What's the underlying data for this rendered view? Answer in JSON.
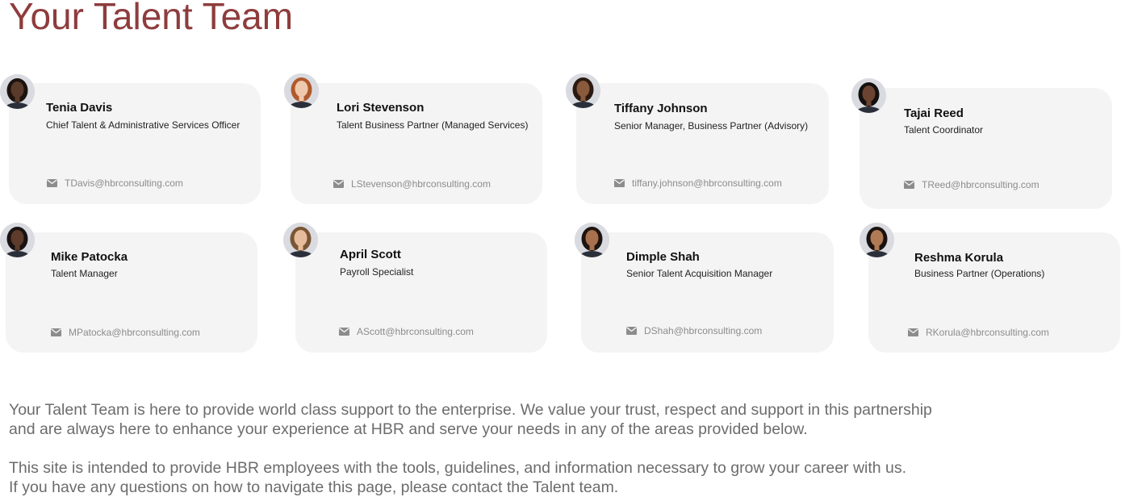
{
  "page": {
    "title": "Your Talent Team"
  },
  "team": [
    {
      "name": "Tenia Davis",
      "role": "Chief Talent & Administrative Services Officer",
      "email": "TDavis@hbrconsulting.com",
      "avatar_icon": "person-avatar-icon",
      "skin": "#5a3a2a",
      "hair": "#1c130f"
    },
    {
      "name": "Lori Stevenson",
      "role": "Talent Business Partner (Managed Services)",
      "email": "LStevenson@hbrconsulting.com",
      "avatar_icon": "person-avatar-icon",
      "skin": "#efc9ae",
      "hair": "#b05a2c"
    },
    {
      "name": "Tiffany Johnson",
      "role": "Senior Manager, Business Partner (Advisory)",
      "email": "tiffany.johnson@hbrconsulting.com",
      "avatar_icon": "person-avatar-icon",
      "skin": "#8a5a3c",
      "hair": "#2a1a12"
    },
    {
      "name": "Tajai Reed",
      "role": "Talent Coordinator",
      "email": "TReed@hbrconsulting.com",
      "avatar_icon": "person-avatar-icon",
      "skin": "#6b4330",
      "hair": "#141010"
    },
    {
      "name": "Mike Patocka",
      "role": "Talent Manager",
      "email": "MPatocka@hbrconsulting.com",
      "avatar_icon": "person-avatar-icon",
      "skin": "#5e3b2a",
      "hair": "#181212"
    },
    {
      "name": "April Scott",
      "role": "Payroll Specialist",
      "email": "AScott@hbrconsulting.com",
      "avatar_icon": "person-avatar-icon",
      "skin": "#e6bc9c",
      "hair": "#7a5535"
    },
    {
      "name": "Dimple Shah",
      "role": "Senior Talent Acquisition Manager",
      "email": "DShah@hbrconsulting.com",
      "avatar_icon": "person-avatar-icon",
      "skin": "#a8704c",
      "hair": "#1e1410"
    },
    {
      "name": "Reshma Korula",
      "role": "Business Partner (Operations)",
      "email": "RKorula@hbrconsulting.com",
      "avatar_icon": "person-avatar-icon",
      "skin": "#b07a55",
      "hair": "#1a1210"
    }
  ],
  "intro": {
    "line1": "Your Talent Team is here to provide world class support to the enterprise. We value your trust, respect and support in this partnership",
    "line2": "and are always here to enhance your experience at HBR and serve your needs in any of the areas provided below.",
    "line3": "This site is intended to provide HBR employees with the tools, guidelines, and information necessary to grow your career with us.",
    "line4": "If you have any questions on how to navigate this page, please contact the Talent team."
  },
  "icons": {
    "email": "mail-icon"
  },
  "colors": {
    "title": "#8e3c3d",
    "card_background": "#f4f4f4",
    "email_text": "#8c8c8c",
    "intro_text": "#6c6c6c"
  }
}
